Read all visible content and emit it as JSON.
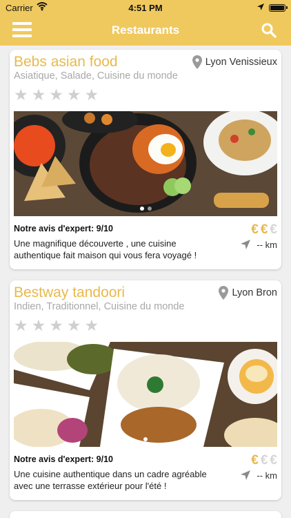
{
  "status_bar": {
    "carrier": "Carrier",
    "time": "4:51 PM"
  },
  "nav": {
    "title": "Restaurants"
  },
  "colors": {
    "accent": "#f0c95e",
    "restaurant_name": "#e8b94c",
    "star_empty": "#cfcfcf"
  },
  "restaurants": [
    {
      "name": "Bebs asian food",
      "city": "Lyon Venissieux",
      "cuisine": "Asiatique, Salade, Cuisine du monde",
      "rating": 0,
      "review_title": "Notre avis d'expert: 9/10",
      "review": "Une magnifique découverte , une cuisine authentique fait maison qui vous fera voyagé !",
      "price_level": 2,
      "price_max": 3,
      "currency_symbol": "€",
      "distance": "-- km",
      "photo_count": 2,
      "photo_active": 0
    },
    {
      "name": "Bestway tandoori",
      "city": "Lyon Bron",
      "cuisine": "Indien, Traditionnel, Cuisine du monde",
      "rating": 0,
      "review_title": "Notre avis d'expert: 9/10",
      "review": "Une cuisine authentique dans un cadre agréable avec une terrasse extérieur pour l'été !",
      "price_level": 1,
      "price_max": 3,
      "currency_symbol": "€",
      "distance": "-- km",
      "photo_count": 1,
      "photo_active": 0
    }
  ]
}
